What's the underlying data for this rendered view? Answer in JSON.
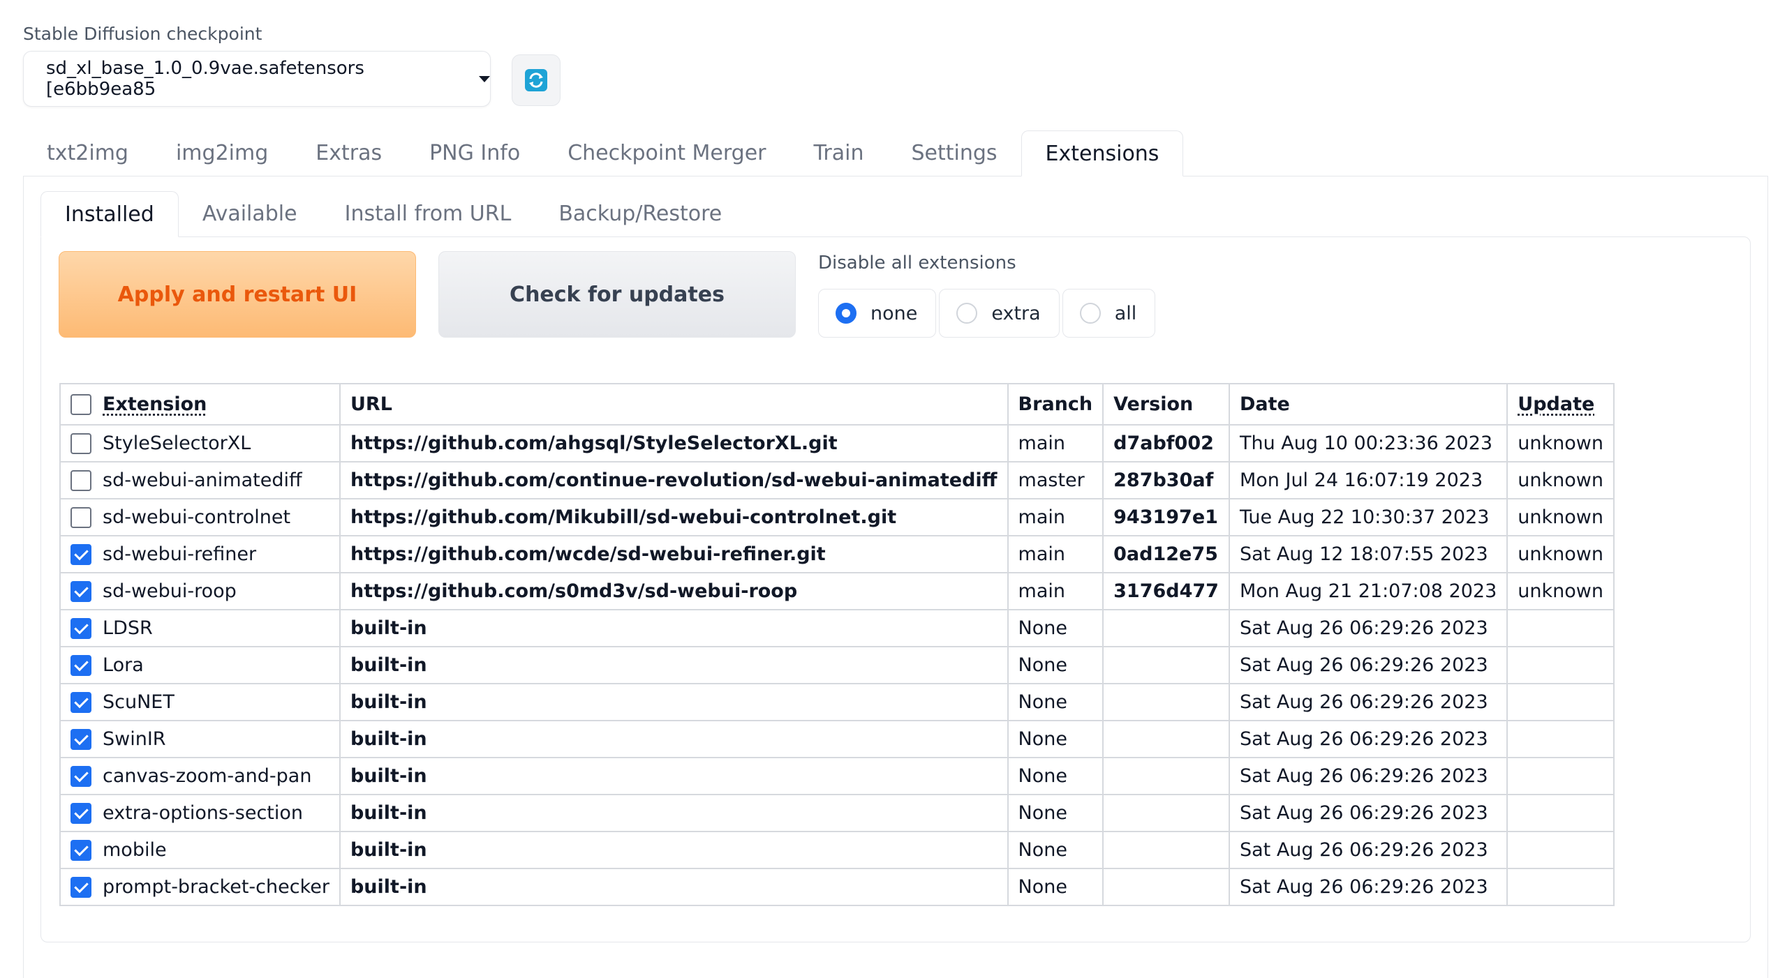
{
  "checkpoint": {
    "label": "Stable Diffusion checkpoint",
    "value": "sd_xl_base_1.0_0.9vae.safetensors [e6bb9ea85"
  },
  "tabs": [
    "txt2img",
    "img2img",
    "Extras",
    "PNG Info",
    "Checkpoint Merger",
    "Train",
    "Settings",
    "Extensions"
  ],
  "subtabs": [
    "Installed",
    "Available",
    "Install from URL",
    "Backup/Restore"
  ],
  "buttons": {
    "apply": "Apply and restart UI",
    "check": "Check for updates"
  },
  "disable": {
    "label": "Disable all extensions",
    "options": [
      "none",
      "extra",
      "all"
    ],
    "selected": "none"
  },
  "table": {
    "headers": [
      "Extension",
      "URL",
      "Branch",
      "Version",
      "Date",
      "Update"
    ],
    "rows": [
      {
        "name": "StyleSelectorXL",
        "url": "https://github.com/ahgsql/StyleSelectorXL.git",
        "branch": "main",
        "version": "d7abf002",
        "date": "Thu Aug 10 00:23:36 2023",
        "update": "unknown",
        "checked": false
      },
      {
        "name": "sd-webui-animatediff",
        "url": "https://github.com/continue-revolution/sd-webui-animatediff",
        "branch": "master",
        "version": "287b30af",
        "date": "Mon Jul 24 16:07:19 2023",
        "update": "unknown",
        "checked": false
      },
      {
        "name": "sd-webui-controlnet",
        "url": "https://github.com/Mikubill/sd-webui-controlnet.git",
        "branch": "main",
        "version": "943197e1",
        "date": "Tue Aug 22 10:30:37 2023",
        "update": "unknown",
        "checked": false
      },
      {
        "name": "sd-webui-refiner",
        "url": "https://github.com/wcde/sd-webui-refiner.git",
        "branch": "main",
        "version": "0ad12e75",
        "date": "Sat Aug 12 18:07:55 2023",
        "update": "unknown",
        "checked": true
      },
      {
        "name": "sd-webui-roop",
        "url": "https://github.com/s0md3v/sd-webui-roop",
        "branch": "main",
        "version": "3176d477",
        "date": "Mon Aug 21 21:07:08 2023",
        "update": "unknown",
        "checked": true
      },
      {
        "name": "LDSR",
        "url": "built-in",
        "branch": "None",
        "version": "",
        "date": "Sat Aug 26 06:29:26 2023",
        "update": "",
        "checked": true
      },
      {
        "name": "Lora",
        "url": "built-in",
        "branch": "None",
        "version": "",
        "date": "Sat Aug 26 06:29:26 2023",
        "update": "",
        "checked": true
      },
      {
        "name": "ScuNET",
        "url": "built-in",
        "branch": "None",
        "version": "",
        "date": "Sat Aug 26 06:29:26 2023",
        "update": "",
        "checked": true
      },
      {
        "name": "SwinIR",
        "url": "built-in",
        "branch": "None",
        "version": "",
        "date": "Sat Aug 26 06:29:26 2023",
        "update": "",
        "checked": true
      },
      {
        "name": "canvas-zoom-and-pan",
        "url": "built-in",
        "branch": "None",
        "version": "",
        "date": "Sat Aug 26 06:29:26 2023",
        "update": "",
        "checked": true
      },
      {
        "name": "extra-options-section",
        "url": "built-in",
        "branch": "None",
        "version": "",
        "date": "Sat Aug 26 06:29:26 2023",
        "update": "",
        "checked": true
      },
      {
        "name": "mobile",
        "url": "built-in",
        "branch": "None",
        "version": "",
        "date": "Sat Aug 26 06:29:26 2023",
        "update": "",
        "checked": true
      },
      {
        "name": "prompt-bracket-checker",
        "url": "built-in",
        "branch": "None",
        "version": "",
        "date": "Sat Aug 26 06:29:26 2023",
        "update": "",
        "checked": true
      }
    ]
  },
  "colors": {
    "accent": "#1d6ff2",
    "apply_text": "#ea580c",
    "apply_bg": "#fdba74"
  },
  "icons": {
    "refresh": "refresh-icon",
    "dropdown": "chevron-down-icon"
  }
}
